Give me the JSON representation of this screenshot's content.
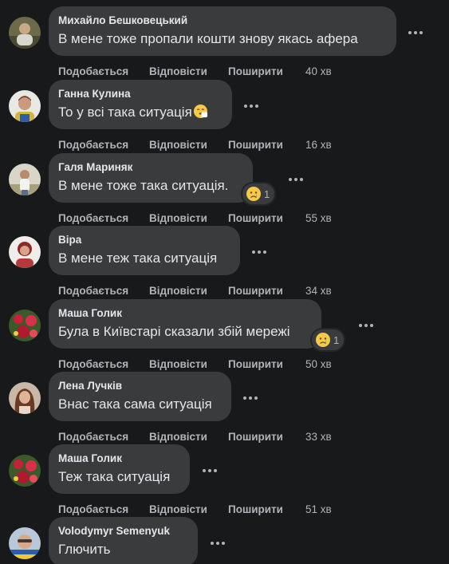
{
  "actions": {
    "like": "Подобається",
    "reply": "Відповісти",
    "share": "Поширити"
  },
  "colors": {
    "background": "#18191a",
    "bubble": "#3a3b3c",
    "text_primary": "#e4e6eb",
    "text_secondary": "#b0b3b8"
  },
  "icons": {
    "more": "more-options-icon",
    "sad_reaction": "sad-reaction-icon",
    "sneeze_emoji": "sneezing-face-emoji"
  },
  "comments": [
    {
      "author": "Михайло Бешковецький",
      "text": "В мене тоже пропали кошти знову якась афера",
      "time": "40 хв"
    },
    {
      "author": "Ганна Кулина",
      "text": "То у всі така ситуація",
      "emoji": "sneezing-face-emoji",
      "time": "16 хв"
    },
    {
      "author": "Галя Мариняк",
      "text": "В мене тоже така ситуація.",
      "reaction_count": "1",
      "time": "55 хв"
    },
    {
      "author": "Віра",
      "text": "В мене теж така ситуація",
      "time": "34 хв"
    },
    {
      "author": "Маша Голик",
      "text": "Була в Київстарі сказали збій мережі",
      "reaction_count": "1",
      "time": "50 хв"
    },
    {
      "author": "Лена Лучків",
      "text": "Внас така сама ситуація",
      "time": "33 хв"
    },
    {
      "author": "Маша Голик",
      "text": "Теж така ситуація",
      "time": "51 хв"
    },
    {
      "author": "Volodymyr Semenyuk",
      "text": "Глючить"
    }
  ]
}
